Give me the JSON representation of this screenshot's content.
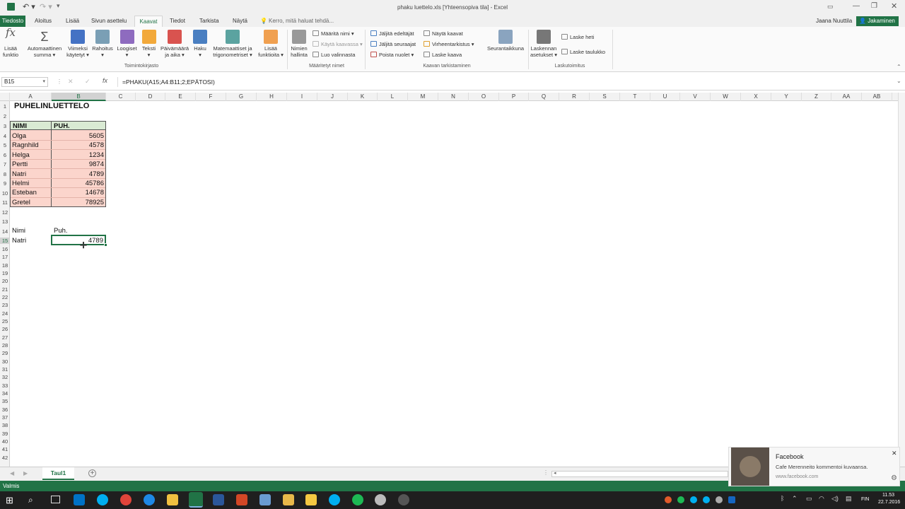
{
  "window": {
    "title": "phaku luettelo.xls  [Yhteensopiva tila] - Excel",
    "user": "Jaana Nuuttila",
    "share": "Jakaminen"
  },
  "tabs": [
    "Tiedosto",
    "Aloitus",
    "Lisää",
    "Sivun asettelu",
    "Kaavat",
    "Tiedot",
    "Tarkista",
    "Näytä"
  ],
  "tellme": "Kerro, mitä haluat tehdä...",
  "ribbon": {
    "insert_fn": [
      "Lisää",
      "funktio"
    ],
    "autosum": [
      "Automaattinen",
      "summa ▾"
    ],
    "recent": [
      "Viimeksi",
      "käytetyt ▾"
    ],
    "finance": [
      "Rahoitus",
      "▾"
    ],
    "logical": [
      "Loogiset",
      "▾"
    ],
    "text": [
      "Teksti",
      "▾"
    ],
    "datetime": [
      "Päivämäärä",
      "ja aika ▾"
    ],
    "lookup": [
      "Haku",
      "▾"
    ],
    "math": [
      "Matemaattiset ja",
      "trigonometriset ▾"
    ],
    "more": [
      "Lisää",
      "funktioita ▾"
    ],
    "group_library": "Toimintokirjasto",
    "name_mgr": [
      "Nimien",
      "hallinta"
    ],
    "define_name": "Määritä nimi ▾",
    "use_in_formula": "Käytä kaavassa ▾",
    "create_sel": "Luo valinnasta",
    "group_names": "Määritetyt nimet",
    "trace_prec": "Jäljitä edeltäjät",
    "trace_dep": "Jäljitä seuraajat",
    "remove_arrows": "Poista nuolet ▾",
    "show_formulas": "Näytä kaavat",
    "error_check": "Virheentarkistus ▾",
    "eval_formula": "Laske kaava",
    "watch": "Seurantaikkuna",
    "group_audit": "Kaavan tarkistaminen",
    "calc_opts": [
      "Laskennan",
      "asetukset ▾"
    ],
    "calc_now": "Laske heti",
    "calc_sheet": "Laske taulukko",
    "group_calc": "Laskutoimitus"
  },
  "formula_bar": {
    "namebox": "B15",
    "fx": "fx",
    "formula": "=PHAKU(A15;A4:B11;2;EPÄTOSI)"
  },
  "columns": [
    "A",
    "B",
    "C",
    "D",
    "E",
    "F",
    "G",
    "H",
    "I",
    "J",
    "K",
    "L",
    "M",
    "N",
    "O",
    "P",
    "Q",
    "R",
    "S",
    "T",
    "U",
    "V",
    "W",
    "X",
    "Y",
    "Z",
    "AA",
    "AB"
  ],
  "rows": [
    "1",
    "2",
    "3",
    "4",
    "5",
    "6",
    "7",
    "8",
    "9",
    "10",
    "11",
    "12",
    "13",
    "14",
    "15",
    "16",
    "17",
    "18",
    "19",
    "20",
    "21",
    "22",
    "23",
    "24",
    "25",
    "26",
    "27",
    "28",
    "29",
    "30",
    "31",
    "32",
    "33",
    "34",
    "35",
    "36",
    "37",
    "38",
    "39",
    "40",
    "41",
    "42"
  ],
  "sheet": {
    "title": "PUHELINLUETTELO",
    "header_name": "NIMI",
    "header_phone": "PUH.",
    "entries": [
      {
        "name": "Olga",
        "phone": "5605"
      },
      {
        "name": "Ragnhild",
        "phone": "4578"
      },
      {
        "name": "Helga",
        "phone": "1234"
      },
      {
        "name": "Pertti",
        "phone": "9874"
      },
      {
        "name": "Natri",
        "phone": "4789"
      },
      {
        "name": "Helmi",
        "phone": "45786"
      },
      {
        "name": "Esteban",
        "phone": "14678"
      },
      {
        "name": "Gretel",
        "phone": "78925"
      }
    ],
    "lookup_label_name": "Nimi",
    "lookup_label_phone": "Puh.",
    "lookup_name": "Natri",
    "lookup_result": "4789"
  },
  "sheet_tab": "Taul1",
  "status": "Valmis",
  "zoom": "100 %",
  "toast": {
    "app": "Facebook",
    "message": "Cafe Merenneito kommentoi kuvaansa.",
    "site": "www.facebook.com"
  },
  "tray": {
    "lang": "FIN",
    "time": "11.53",
    "date": "22.7.2016"
  },
  "colors": {
    "excel_green": "#217346",
    "header_fill": "#d9ead3",
    "data_fill": "#fbd5cc"
  }
}
